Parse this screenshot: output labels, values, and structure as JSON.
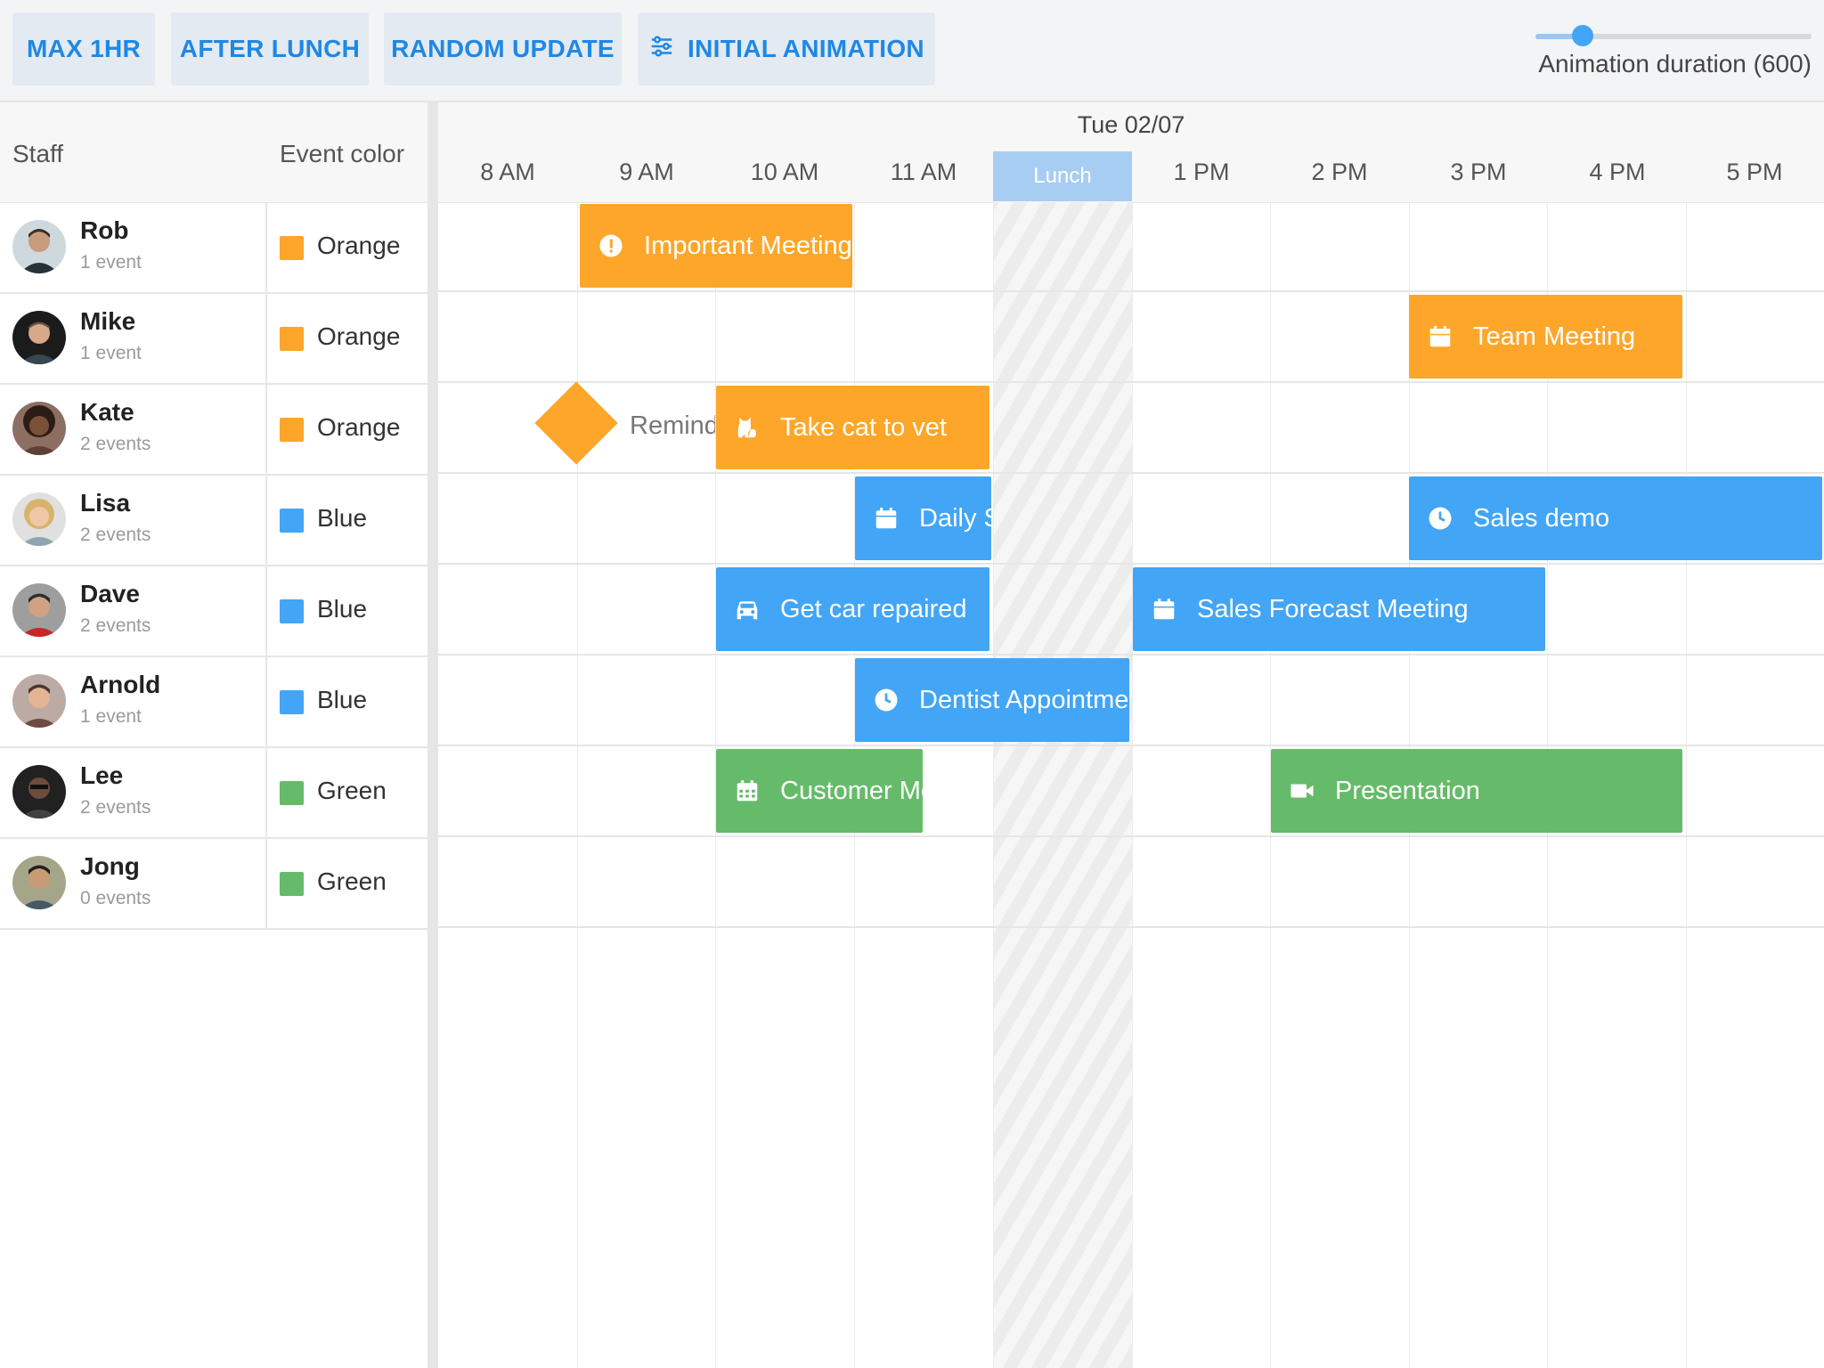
{
  "toolbar": {
    "buttons": [
      "MAX 1HR",
      "AFTER LUNCH",
      "RANDOM UPDATE",
      "INITIAL ANIMATION"
    ],
    "slider": {
      "label": "Animation duration (600)",
      "value": 600,
      "fraction": 0.17
    }
  },
  "grid": {
    "headers": {
      "staff": "Staff",
      "event_color": "Event color"
    },
    "rows": [
      {
        "name": "Rob",
        "events": "1 event",
        "color_name": "Orange",
        "color": "#fda62a"
      },
      {
        "name": "Mike",
        "events": "1 event",
        "color_name": "Orange",
        "color": "#fda62a"
      },
      {
        "name": "Kate",
        "events": "2 events",
        "color_name": "Orange",
        "color": "#fda62a"
      },
      {
        "name": "Lisa",
        "events": "2 events",
        "color_name": "Blue",
        "color": "#42a5f5"
      },
      {
        "name": "Dave",
        "events": "2 events",
        "color_name": "Blue",
        "color": "#42a5f5"
      },
      {
        "name": "Arnold",
        "events": "1 event",
        "color_name": "Blue",
        "color": "#42a5f5"
      },
      {
        "name": "Lee",
        "events": "2 events",
        "color_name": "Green",
        "color": "#66bb6a"
      },
      {
        "name": "Jong",
        "events": "0 events",
        "color_name": "Green",
        "color": "#66bb6a"
      }
    ]
  },
  "timeline": {
    "date": "Tue 02/07",
    "hours": [
      "8 AM",
      "9 AM",
      "10 AM",
      "11 AM",
      "Lunch",
      "1 PM",
      "2 PM",
      "3 PM",
      "4 PM",
      "5 PM"
    ],
    "events": {
      "important_meeting": "Important Meeting",
      "team_meeting": "Team Meeting",
      "reminder": "Reminder",
      "take_cat": "Take cat to vet",
      "daily_standup": "Daily Stand-up",
      "sales_demo": "Sales demo",
      "car_repair": "Get car repaired",
      "sales_forecast": "Sales Forecast Meeting",
      "dentist": "Dentist Appointment",
      "customer_meeting": "Customer Meeting",
      "presentation": "Presentation"
    },
    "icons": {
      "important_meeting": "exclamation-circle-icon",
      "team_meeting": "calendar-icon",
      "take_cat": "cat-icon",
      "daily_standup": "calendar-icon",
      "sales_demo": "clock-icon",
      "car_repair": "car-icon",
      "sales_forecast": "calendar-icon",
      "dentist": "clock-icon",
      "customer_meeting": "calendar-grid-icon",
      "presentation": "video-icon"
    }
  }
}
